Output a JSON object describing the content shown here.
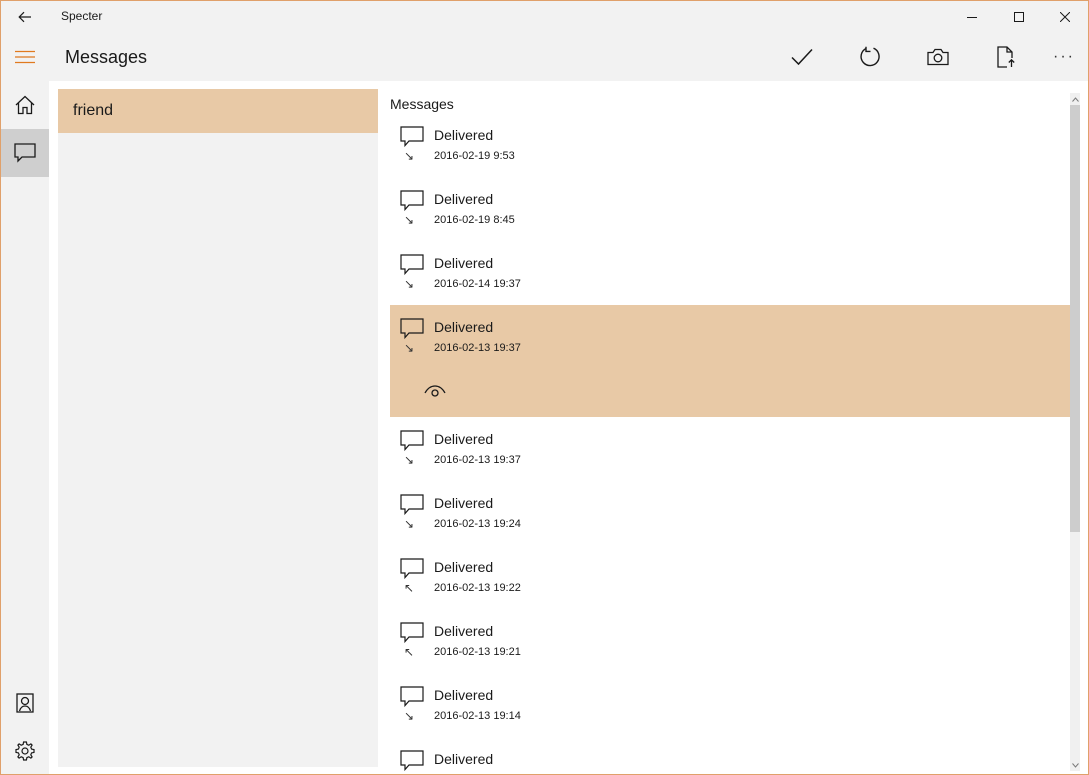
{
  "window": {
    "title": "Specter"
  },
  "header": {
    "title": "Messages"
  },
  "conversations": [
    {
      "label": "friend"
    }
  ],
  "messages": {
    "header": "Messages",
    "items": [
      {
        "status": "Delivered",
        "time": "2016-02-19 9:53",
        "direction": "incoming",
        "arrow": "↘",
        "selected": false
      },
      {
        "status": "Delivered",
        "time": "2016-02-19 8:45",
        "direction": "incoming",
        "arrow": "↘",
        "selected": false
      },
      {
        "status": "Delivered",
        "time": "2016-02-14 19:37",
        "direction": "incoming",
        "arrow": "↘",
        "selected": false
      },
      {
        "status": "Delivered",
        "time": "2016-02-13 19:37",
        "direction": "incoming",
        "arrow": "↘",
        "selected": true
      },
      {
        "status": "Delivered",
        "time": "2016-02-13 19:37",
        "direction": "incoming",
        "arrow": "↘",
        "selected": false
      },
      {
        "status": "Delivered",
        "time": "2016-02-13 19:24",
        "direction": "incoming",
        "arrow": "↘",
        "selected": false
      },
      {
        "status": "Delivered",
        "time": "2016-02-13 19:22",
        "direction": "outgoing",
        "arrow": "↖",
        "selected": false
      },
      {
        "status": "Delivered",
        "time": "2016-02-13 19:21",
        "direction": "outgoing",
        "arrow": "↖",
        "selected": false
      },
      {
        "status": "Delivered",
        "time": "2016-02-13 19:14",
        "direction": "incoming",
        "arrow": "↘",
        "selected": false
      },
      {
        "status": "Delivered",
        "time": "",
        "direction": "",
        "arrow": "",
        "selected": false
      }
    ]
  },
  "icons": {
    "back": "back-arrow-icon",
    "minimize": "minimize-icon",
    "maximize": "maximize-icon",
    "close": "close-icon",
    "hamburger": "hamburger-menu-icon",
    "check": "check-icon",
    "refresh": "refresh-icon",
    "camera": "camera-icon",
    "export": "export-file-icon",
    "more": "more-icon",
    "home": "home-icon",
    "chat": "chat-bubble-icon",
    "contact": "contact-icon",
    "settings": "gear-icon",
    "eye": "eye-icon"
  },
  "colors": {
    "accent": "#e8c9a6",
    "hamburger": "#e07a1f",
    "border": "#e0a06a",
    "chrome": "#f2f2f2"
  }
}
